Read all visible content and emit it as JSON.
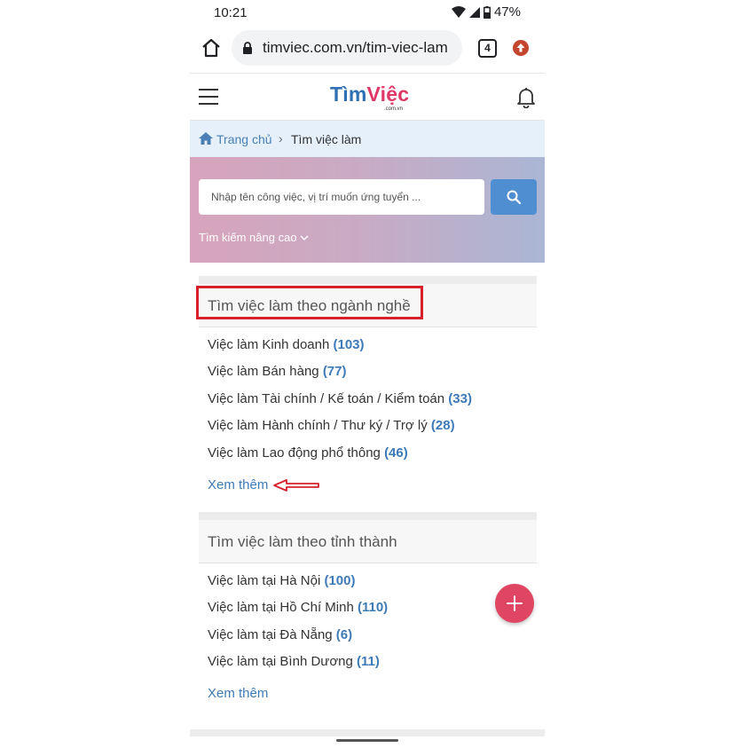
{
  "status_bar": {
    "time": "10:21",
    "battery": "47%"
  },
  "browser": {
    "url": "timviec.com.vn/tim-viec-lam",
    "tab_count": "4"
  },
  "site": {
    "logo_tim": "Tìm",
    "logo_viec": "Việc",
    "logo_sub": ".com.vn"
  },
  "breadcrumb": {
    "home": "Trang chủ",
    "separator": "›",
    "current": "Tìm việc làm"
  },
  "search": {
    "placeholder": "Nhập tên công việc, vị trí muốn ứng tuyển ...",
    "advanced": "Tìm kiếm nâng cao"
  },
  "sections": [
    {
      "title": "Tìm việc làm theo ngành nghề",
      "items": [
        {
          "label": "Việc làm Kinh doanh",
          "count": "(103)"
        },
        {
          "label": "Việc làm Bán hàng",
          "count": "(77)"
        },
        {
          "label": "Việc làm Tài chính / Kế toán / Kiểm toán",
          "count": "(33)"
        },
        {
          "label": "Việc làm Hành chính / Thư ký / Trợ lý",
          "count": "(28)"
        },
        {
          "label": "Việc làm Lao động phổ thông",
          "count": "(46)"
        }
      ],
      "more": "Xem thêm"
    },
    {
      "title": "Tìm việc làm theo tỉnh thành",
      "items": [
        {
          "label": "Việc làm tại Hà Nội",
          "count": "(100)"
        },
        {
          "label": "Việc làm tại Hồ Chí Minh",
          "count": "(110)"
        },
        {
          "label": "Việc làm tại Đà Nẵng",
          "count": "(6)"
        },
        {
          "label": "Việc làm tại Bình Dương",
          "count": "(11)"
        }
      ],
      "more": "Xem thêm"
    }
  ],
  "colors": {
    "brand_blue": "#2f6fb3",
    "brand_pink": "#e03866",
    "link": "#3d7ab8",
    "annotation_red": "#d6202c",
    "fab": "#e04664"
  },
  "icons": [
    "wifi-icon",
    "signal-icon",
    "battery-icon",
    "home-icon",
    "lock-icon",
    "tabs-icon",
    "update-icon",
    "menu-icon",
    "bell-icon",
    "search-icon",
    "chevron-down-icon",
    "plus-icon",
    "arrow-annotation-icon"
  ]
}
